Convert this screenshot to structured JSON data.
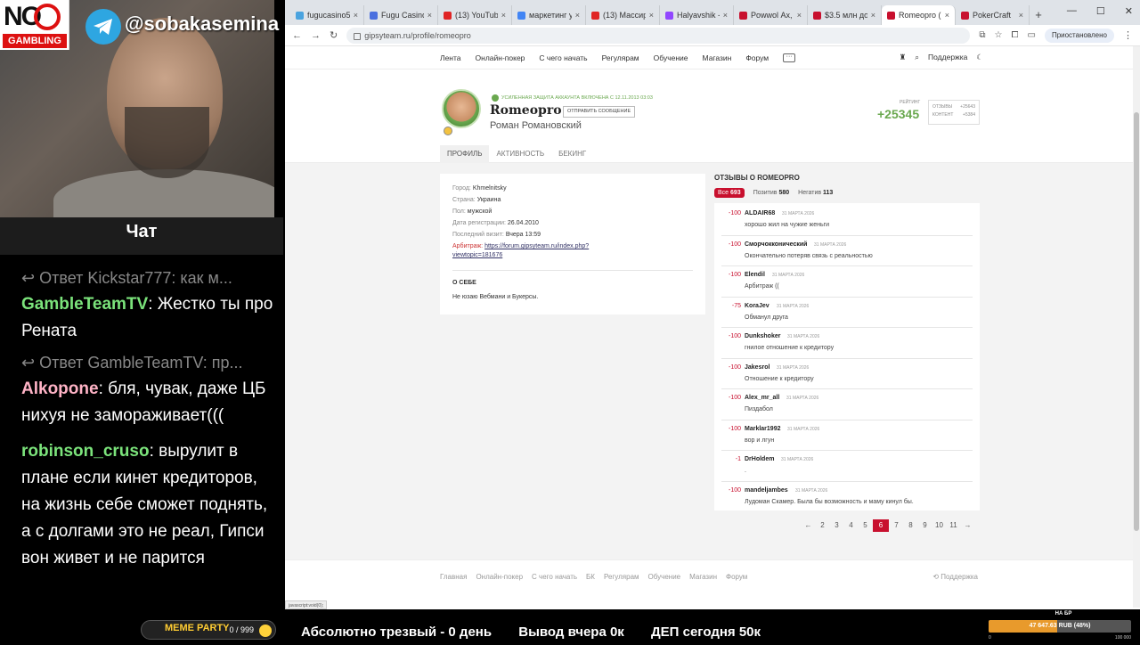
{
  "overlay": {
    "logo_top": "NO",
    "logo_bottom": "GAMBLING",
    "telegram": "@sobakasemina",
    "chat_title": "Чат",
    "chat": [
      {
        "type": "reply",
        "text": "Ответ Kickstar777: как м..."
      },
      {
        "type": "msg",
        "user": "GambleTeamTV",
        "color": "#7be37b",
        "text": ": Жестко ты про Рената"
      },
      {
        "type": "reply",
        "text": "Ответ GambleTeamTV: пр..."
      },
      {
        "type": "msg",
        "user": "Alkopone",
        "color": "#ffb3c6",
        "text": ": бля, чувак, даже ЦБ нихуя не замораживает((("
      },
      {
        "type": "msg",
        "user": "robinson_cruso",
        "color": "#7be37b",
        "text": ": вырулит в плане если кинет кредиторов, на жизнь себе сможет поднять, а с долгами это не реал, Гипси вон живет и не парится"
      }
    ],
    "meme_label": "MEME PARTY",
    "meme_count": "0 / 999",
    "ticker": [
      "Абсолютно трезвый - 0 день",
      "Вывод вчера 0к",
      "ДЕП сегодня 50к"
    ],
    "goal": {
      "label": "НА БР",
      "text": "47 647.63 RUB (48%)",
      "min": "0",
      "max": "100 000",
      "fraction": 0.48
    }
  },
  "browser": {
    "tabs": [
      {
        "title": "fugucasino59.com",
        "color": "#4aa3df",
        "active": false
      },
      {
        "title": "Fugu Casino (Фугу",
        "color": "#4a6fdf",
        "active": false
      },
      {
        "title": "(13) YouTube",
        "color": "#e02424",
        "active": false
      },
      {
        "title": "маркетинг ударил",
        "color": "#4285f4",
        "active": false
      },
      {
        "title": "(13) Массировани",
        "color": "#e02424",
        "active": false
      },
      {
        "title": "Halyavshik - Twitch",
        "color": "#9146ff",
        "active": false
      },
      {
        "title": "Powwol Ах, зачем",
        "color": "#c8102e",
        "active": false
      },
      {
        "title": "$3.5 млн долгов, /",
        "color": "#c8102e",
        "active": false
      },
      {
        "title": "Romeopro (Роман",
        "color": "#c8102e",
        "active": true
      },
      {
        "title": "PokerCraft",
        "color": "#c8102e",
        "active": false
      }
    ],
    "url": "gipsyteam.ru/profile/romeopro",
    "profile_chip": "Приостановлено",
    "status_url": "javascript:void(0);"
  },
  "site": {
    "nav": [
      "Лента",
      "Онлайн-покер",
      "С чего начать",
      "Регулярам",
      "Обучение",
      "Магазин",
      "Форум"
    ],
    "more": "···",
    "support": "Поддержка"
  },
  "profile": {
    "secure_text": "УСИЛЕННАЯ ЗАЩИТА АККАУНТА ВКЛЮЧЕНА С 12.11.2013 03:03",
    "username": "Romeopro",
    "send_message": "ОТПРАВИТЬ СООБЩЕНИЕ",
    "real_name": "Роман Романовский",
    "rating_label": "РЕЙТИНГ",
    "rating": "+25345",
    "rating_reviews_label": "ОТЗЫВЫ",
    "rating_reviews": "+25643",
    "rating_content_label": "КОНТЕНТ",
    "rating_content": "+5384",
    "tabs": [
      "ПРОФИЛЬ",
      "АКТИВНОСТЬ",
      "БЕКИНГ"
    ],
    "info": [
      {
        "k": "Город:",
        "v": "Khmelnitsky"
      },
      {
        "k": "Страна:",
        "v": "Украина"
      },
      {
        "k": "Пол:",
        "v": "мужской"
      },
      {
        "k": "Дата регистрации:",
        "v": "26.04.2010"
      },
      {
        "k": "Последний визит:",
        "v": "Вчера 13:59"
      }
    ],
    "arbitrage_label": "Арбитраж:",
    "arbitrage_link1": "https://forum.gipsyteam.ru/index.php?",
    "arbitrage_link2": "viewtopic=181676",
    "about_title": "О СЕБЕ",
    "about_text": "Не юзаю Вебмани и Букерсы."
  },
  "reviews": {
    "title": "ОТЗЫВЫ О ROMEOPRO",
    "filters": {
      "all_label": "Все",
      "all": "693",
      "pos_label": "Позитив",
      "pos": "580",
      "neg_label": "Негатив",
      "neg": "113"
    },
    "items": [
      {
        "score": "-100",
        "author": "ALDAIR68",
        "date": "31 МАРТА 2026",
        "text": "хорошо жил на чужие женьги"
      },
      {
        "score": "-100",
        "author": "Сморчокконический",
        "date": "31 МАРТА 2026",
        "text": "Окончательно потеряв связь с реальностью"
      },
      {
        "score": "-100",
        "author": "Elendil",
        "date": "31 МАРТА 2026",
        "text": "Арбитраж (("
      },
      {
        "score": "-75",
        "author": "KoraJev",
        "date": "31 МАРТА 2026",
        "text": "Обманул друга"
      },
      {
        "score": "-100",
        "author": "Dunkshoker",
        "date": "31 МАРТА 2026",
        "text": "гнилое отношение к кредитору"
      },
      {
        "score": "-100",
        "author": "Jakesrol",
        "date": "31 МАРТА 2026",
        "text": "Отношение к кредитору"
      },
      {
        "score": "-100",
        "author": "Alex_mr_all",
        "date": "31 МАРТА 2026",
        "text": "Пиздабол"
      },
      {
        "score": "-100",
        "author": "Marklar1992",
        "date": "31 МАРТА 2026",
        "text": "вор и лгун"
      },
      {
        "score": "-1",
        "author": "DrHoldem",
        "date": "31 МАРТА 2026",
        "text": "."
      },
      {
        "score": "-100",
        "author": "mandeljambes",
        "date": "31 МАРТА 2026",
        "text": "Лудоман Скамер. Была бы возможность и маму кинул бы."
      }
    ],
    "pager": [
      "←",
      "2",
      "3",
      "4",
      "5",
      "6",
      "7",
      "8",
      "9",
      "10",
      "11",
      "→"
    ],
    "current_page": "6"
  },
  "footer": {
    "nav": [
      "Главная",
      "Онлайн-покер",
      "С чего начать",
      "БК",
      "Регулярам",
      "Обучение",
      "Магазин",
      "Форум"
    ],
    "support": "Поддержка"
  }
}
